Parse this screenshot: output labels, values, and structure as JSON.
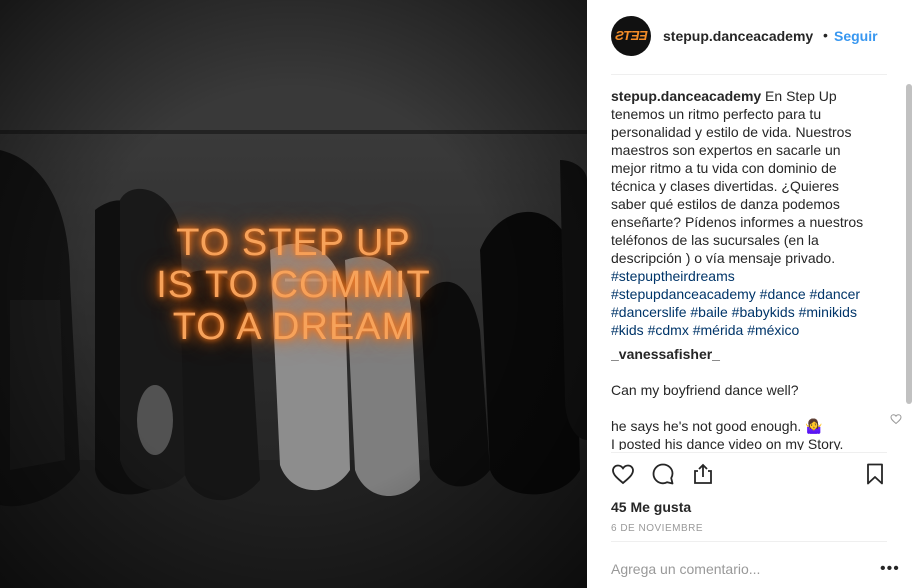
{
  "post": {
    "image": {
      "overlay_lines": [
        "TO STEP UP",
        "IS TO COMMIT",
        "TO A DREAM"
      ]
    },
    "header": {
      "avatar_text": "ƧTƎƎ",
      "username": "stepup.danceacademy",
      "separator": "•",
      "follow_label": "Seguir"
    },
    "caption": {
      "username": "stepup.danceacademy",
      "text": " En Step Up tenemos un ritmo perfecto para tu personalidad y estilo de vida. Nuestros maestros son expertos en sacarle un mejor ritmo a tu vida con dominio de técnica y clases divertidas. ¿Quieres saber qué estilos de danza podemos enseñarte? Pídenos informes a nuestros teléfonos de las sucursales (en la descripción ) o vía mensaje privado. ",
      "hashtags": [
        "#stepuptheirdreams",
        "#stepupdanceacademy",
        "#dance",
        "#dancer",
        "#dancerslife",
        "#baile",
        "#babykids",
        "#minikids",
        "#kids",
        "#cdmx",
        "#mérida",
        "#méxico"
      ]
    },
    "comment": {
      "username": "_vanessafisher_",
      "line1": "Can my boyfriend dance well?",
      "line2": "he says he's not good enough. 🤷‍♀️",
      "line3": "I posted his dance video on my Story."
    },
    "likes": "45 Me gusta",
    "date": "6 DE NOVIEMBRE",
    "comment_input": {
      "placeholder": "Agrega un comentario..."
    },
    "more_label": "•••",
    "icons": {
      "like": "heart-icon",
      "comment": "speech-bubble-icon",
      "share": "share-icon",
      "save": "bookmark-icon",
      "comment_like": "heart-outline-icon"
    },
    "colors": {
      "link": "#3897f0",
      "hashtag": "#003569",
      "neon": "#f7a25a",
      "text": "#262626",
      "muted": "#999999"
    }
  }
}
